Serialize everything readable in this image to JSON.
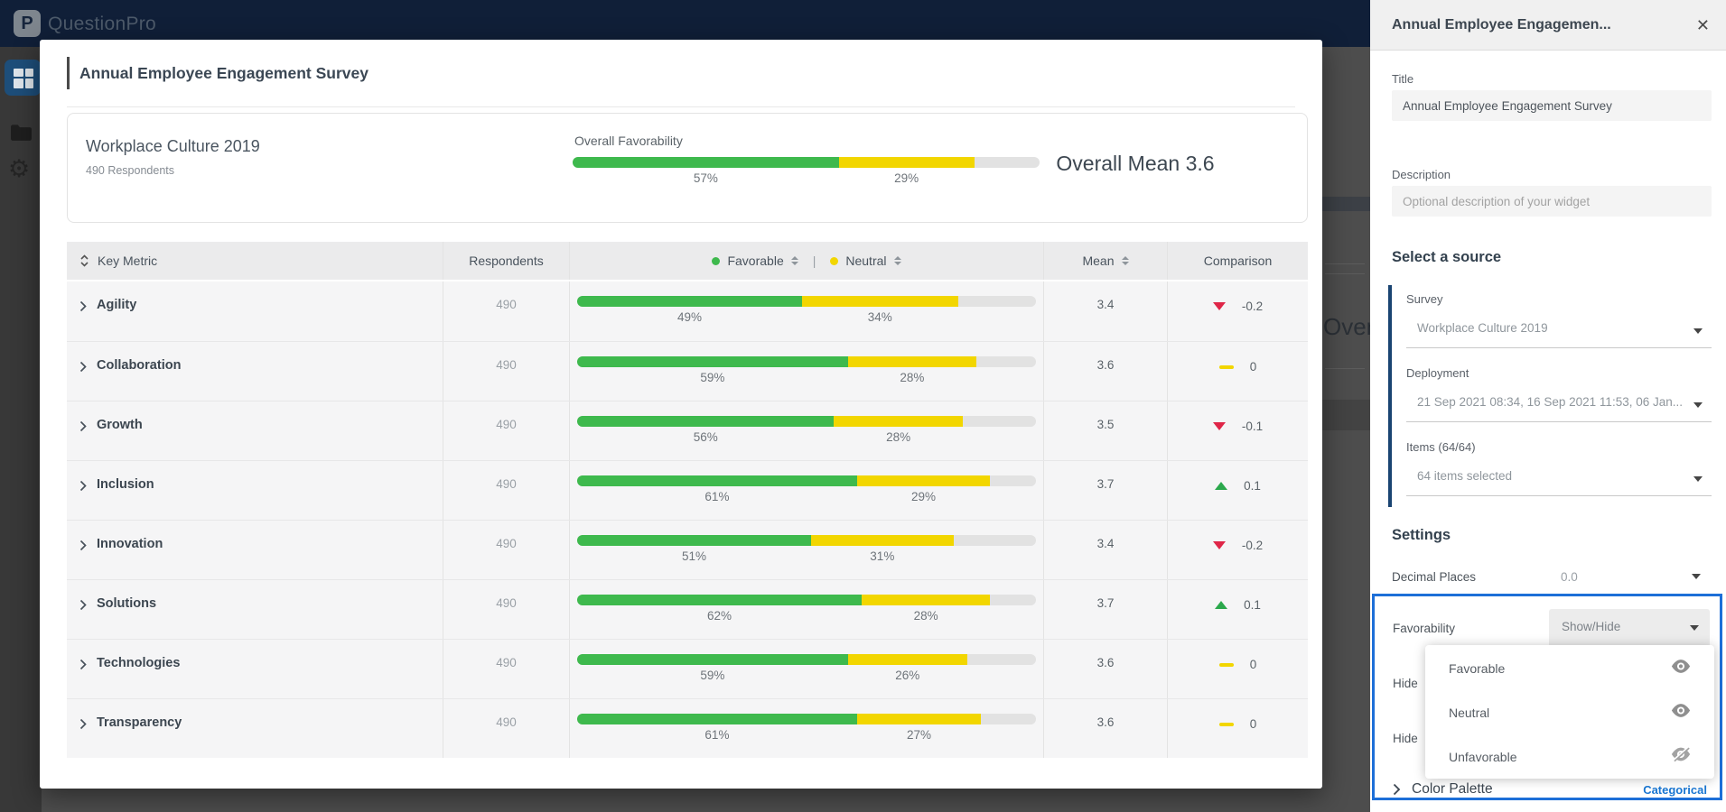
{
  "header": {
    "brand": "QuestionPro",
    "logo_glyph": "P"
  },
  "sidebar": {
    "items": [
      "dashboard",
      "folders",
      "settings"
    ]
  },
  "background": {
    "clipped_text": "Over"
  },
  "modal": {
    "title": "Annual Employee Engagement Survey",
    "summary": {
      "survey_name": "Workplace Culture 2019",
      "respondents_label": "490 Respondents",
      "overall_favorability_label": "Overall Favorability",
      "favorable_pct": 57,
      "neutral_pct": 29,
      "favorable_pct_label": "57%",
      "neutral_pct_label": "29%",
      "overall_mean_label": "Overall Mean 3.6"
    },
    "table": {
      "columns": {
        "key_metric": "Key Metric",
        "respondents": "Respondents",
        "favorable": "Favorable",
        "neutral": "Neutral",
        "separator": "|",
        "mean": "Mean",
        "comparison": "Comparison"
      },
      "rows": [
        {
          "metric": "Agility",
          "respondents": "490",
          "favorable": 49,
          "neutral": 34,
          "favorable_label": "49%",
          "neutral_label": "34%",
          "mean": "3.4",
          "comparison": "-0.2",
          "trend": "down"
        },
        {
          "metric": "Collaboration",
          "respondents": "490",
          "favorable": 59,
          "neutral": 28,
          "favorable_label": "59%",
          "neutral_label": "28%",
          "mean": "3.6",
          "comparison": "0",
          "trend": "flat"
        },
        {
          "metric": "Growth",
          "respondents": "490",
          "favorable": 56,
          "neutral": 28,
          "favorable_label": "56%",
          "neutral_label": "28%",
          "mean": "3.5",
          "comparison": "-0.1",
          "trend": "down"
        },
        {
          "metric": "Inclusion",
          "respondents": "490",
          "favorable": 61,
          "neutral": 29,
          "favorable_label": "61%",
          "neutral_label": "29%",
          "mean": "3.7",
          "comparison": "0.1",
          "trend": "up"
        },
        {
          "metric": "Innovation",
          "respondents": "490",
          "favorable": 51,
          "neutral": 31,
          "favorable_label": "51%",
          "neutral_label": "31%",
          "mean": "3.4",
          "comparison": "-0.2",
          "trend": "down"
        },
        {
          "metric": "Solutions",
          "respondents": "490",
          "favorable": 62,
          "neutral": 28,
          "favorable_label": "62%",
          "neutral_label": "28%",
          "mean": "3.7",
          "comparison": "0.1",
          "trend": "up"
        },
        {
          "metric": "Technologies",
          "respondents": "490",
          "favorable": 59,
          "neutral": 26,
          "favorable_label": "59%",
          "neutral_label": "26%",
          "mean": "3.6",
          "comparison": "0",
          "trend": "flat"
        },
        {
          "metric": "Transparency",
          "respondents": "490",
          "favorable": 61,
          "neutral": 27,
          "favorable_label": "61%",
          "neutral_label": "27%",
          "mean": "3.6",
          "comparison": "0",
          "trend": "flat"
        }
      ]
    }
  },
  "panel": {
    "title": "Annual Employee Engagemen...",
    "close_glyph": "✕",
    "title_field": {
      "label": "Title",
      "value": "Annual Employee Engagement Survey"
    },
    "description_field": {
      "label": "Description",
      "placeholder": "Optional description of your widget"
    },
    "source_section": {
      "heading": "Select a source",
      "survey": {
        "label": "Survey",
        "value": "Workplace Culture 2019"
      },
      "deployment": {
        "label": "Deployment",
        "value": "21 Sep 2021 08:34, 16 Sep 2021 11:53, 06 Jan..."
      },
      "items": {
        "label": "Items (64/64)",
        "value": "64 items selected"
      }
    },
    "settings_section": {
      "heading": "Settings",
      "decimal_places": {
        "label": "Decimal Places",
        "value": "0.0"
      },
      "favorability": {
        "label": "Favorability",
        "value": "Show/Hide",
        "options": [
          {
            "label": "Favorable",
            "visible": true
          },
          {
            "label": "Neutral",
            "visible": true
          },
          {
            "label": "Unfavorable",
            "visible": false
          }
        ]
      },
      "hidden_rows": [
        "Hide",
        "Hide"
      ],
      "color_palette": {
        "label": "Color Palette",
        "value": "Categorical"
      }
    }
  },
  "colors": {
    "favorable_green": "#3eb94d",
    "neutral_yellow": "#f2d600",
    "negative_red": "#df2648",
    "positive_green": "#2ba84c",
    "focus_blue": "#1d6fd8",
    "source_accent_navy": "#1a4472",
    "link_blue": "#1976d2",
    "header_navy": "#101f38"
  }
}
